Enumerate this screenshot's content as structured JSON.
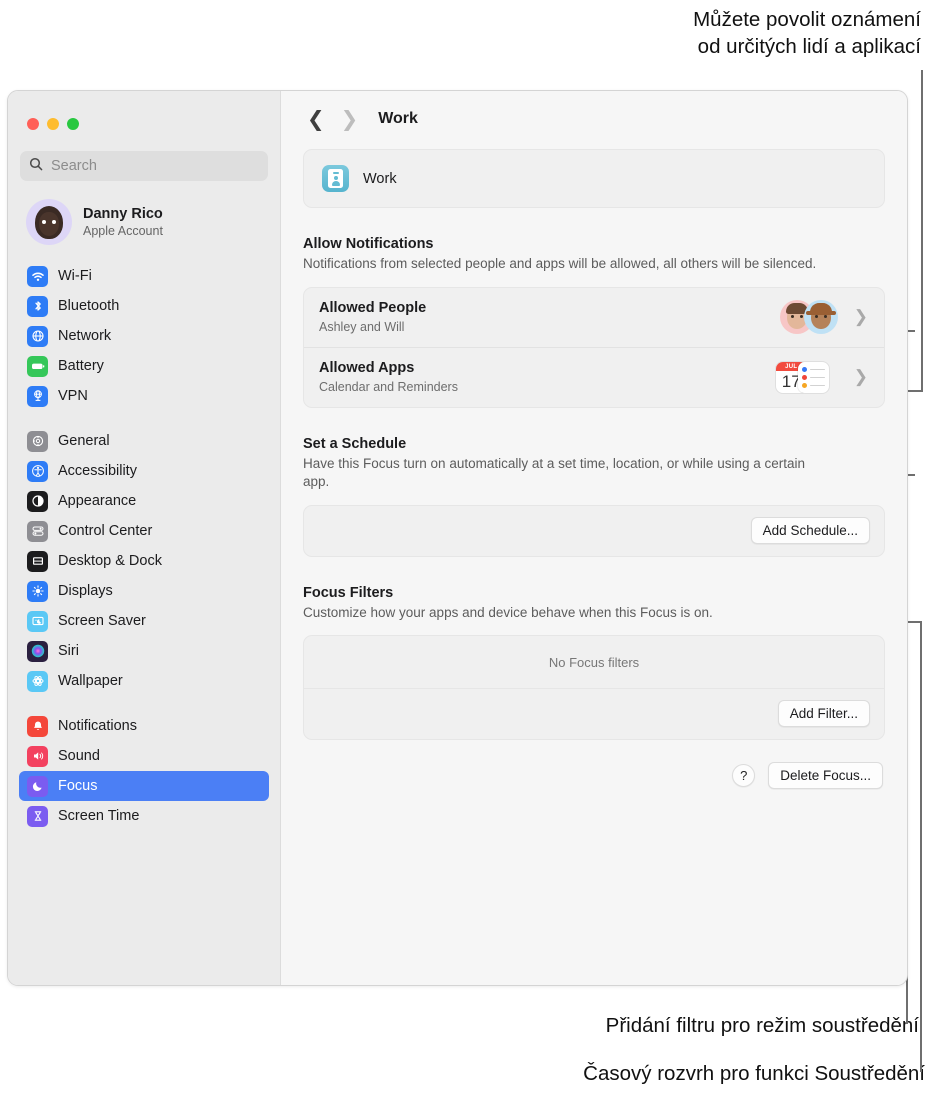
{
  "annotations": {
    "top_line1": "Můžete povolit oznámení",
    "top_line2": "od určitých lidí a aplikací",
    "filter": "Přidání filtru pro režim soustředění",
    "schedule": "Časový rozvrh pro funkci Soustředění"
  },
  "sidebar": {
    "search_placeholder": "Search",
    "account": {
      "name": "Danny Rico",
      "subtitle": "Apple Account"
    },
    "groups": [
      {
        "items": [
          {
            "label": "Wi-Fi",
            "icon": "wifi-icon",
            "color": "#2e7cf6"
          },
          {
            "label": "Bluetooth",
            "icon": "bluetooth-icon",
            "color": "#2e7cf6"
          },
          {
            "label": "Network",
            "icon": "network-globe-icon",
            "color": "#2e7cf6"
          },
          {
            "label": "Battery",
            "icon": "battery-icon",
            "color": "#35c759"
          },
          {
            "label": "VPN",
            "icon": "vpn-icon",
            "color": "#2e7cf6"
          }
        ]
      },
      {
        "items": [
          {
            "label": "General",
            "icon": "gear-icon",
            "color": "#8e8e93"
          },
          {
            "label": "Accessibility",
            "icon": "accessibility-icon",
            "color": "#2e7cf6"
          },
          {
            "label": "Appearance",
            "icon": "appearance-icon",
            "color": "#1c1c1e"
          },
          {
            "label": "Control Center",
            "icon": "control-center-icon",
            "color": "#8e8e93"
          },
          {
            "label": "Desktop & Dock",
            "icon": "desktop-dock-icon",
            "color": "#1c1c1e"
          },
          {
            "label": "Displays",
            "icon": "displays-icon",
            "color": "#2e7cf6"
          },
          {
            "label": "Screen Saver",
            "icon": "screen-saver-icon",
            "color": "#5ac8f5"
          },
          {
            "label": "Siri",
            "icon": "siri-icon",
            "color": "#2b2040"
          },
          {
            "label": "Wallpaper",
            "icon": "wallpaper-icon",
            "color": "#5ac8f5"
          }
        ]
      },
      {
        "items": [
          {
            "label": "Notifications",
            "icon": "notifications-bell-icon",
            "color": "#f4473a"
          },
          {
            "label": "Sound",
            "icon": "sound-speaker-icon",
            "color": "#f3415f"
          },
          {
            "label": "Focus",
            "icon": "focus-moon-icon",
            "color": "#7b5cf0",
            "selected": true
          },
          {
            "label": "Screen Time",
            "icon": "screen-time-hourglass-icon",
            "color": "#7b5cf0"
          }
        ]
      }
    ]
  },
  "main": {
    "breadcrumb": "Work",
    "focus_card": {
      "label": "Work",
      "icon": "work-badge-icon"
    },
    "allow_notifications": {
      "title": "Allow Notifications",
      "description": "Notifications from selected people and apps will be allowed, all others will be silenced.",
      "rows": [
        {
          "title": "Allowed People",
          "subtitle": "Ashley and Will",
          "accessory": "memoji-pair"
        },
        {
          "title": "Allowed Apps",
          "subtitle": "Calendar and Reminders",
          "accessory": "app-icons"
        }
      ]
    },
    "calendar_icon": {
      "month": "JUL",
      "day": "17"
    },
    "set_schedule": {
      "title": "Set a Schedule",
      "description": "Have this Focus turn on automatically at a set time, location, or while using a certain app.",
      "button": "Add Schedule..."
    },
    "focus_filters": {
      "title": "Focus Filters",
      "description": "Customize how your apps and device behave when this Focus is on.",
      "empty": "No Focus filters",
      "button": "Add Filter..."
    },
    "bottom": {
      "help": "?",
      "delete": "Delete Focus..."
    }
  },
  "colors": {
    "accent": "#4b7ff5",
    "card": "#f0f0f0",
    "sidebar": "#ebebeb"
  }
}
